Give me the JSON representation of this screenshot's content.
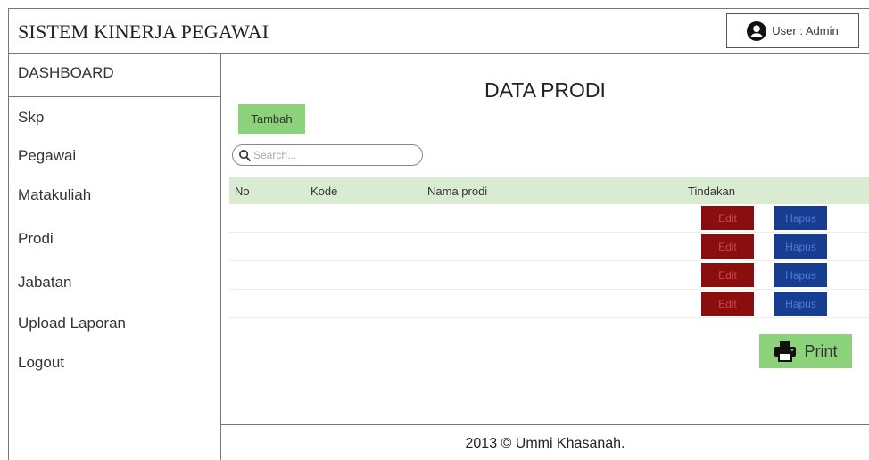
{
  "header": {
    "app_title": "SISTEM KINERJA PEGAWAI",
    "user_label": "User : Admin",
    "user_icon": "user-circle-icon"
  },
  "sidebar": {
    "dashboard": "DASHBOARD",
    "items": [
      {
        "label": "Skp"
      },
      {
        "label": "Pegawai"
      },
      {
        "label": "Matakuliah"
      },
      {
        "label": "Prodi"
      },
      {
        "label": "Jabatan"
      },
      {
        "label": "Upload Laporan"
      },
      {
        "label": "Logout"
      }
    ]
  },
  "main": {
    "title": "DATA PRODI",
    "add_button": "Tambah",
    "search": {
      "placeholder": "Search...",
      "icon": "search-icon"
    },
    "table": {
      "columns": [
        "No",
        "Kode",
        "Nama prodi",
        "Tindakan"
      ],
      "rows": [
        {
          "edit": "Edit",
          "delete": "Hapus"
        },
        {
          "edit": "Edit",
          "delete": "Hapus"
        },
        {
          "edit": "Edit",
          "delete": "Hapus"
        },
        {
          "edit": "Edit",
          "delete": "Hapus"
        }
      ]
    },
    "print_button": {
      "label": "Print",
      "icon": "printer-icon"
    }
  },
  "footer": {
    "text": "2013 © Ummi Khasanah."
  },
  "colors": {
    "green_button": "#8bd27a",
    "table_header": "#d9ecd2",
    "edit_button": "#8b0e0e",
    "delete_button": "#163d8f"
  }
}
